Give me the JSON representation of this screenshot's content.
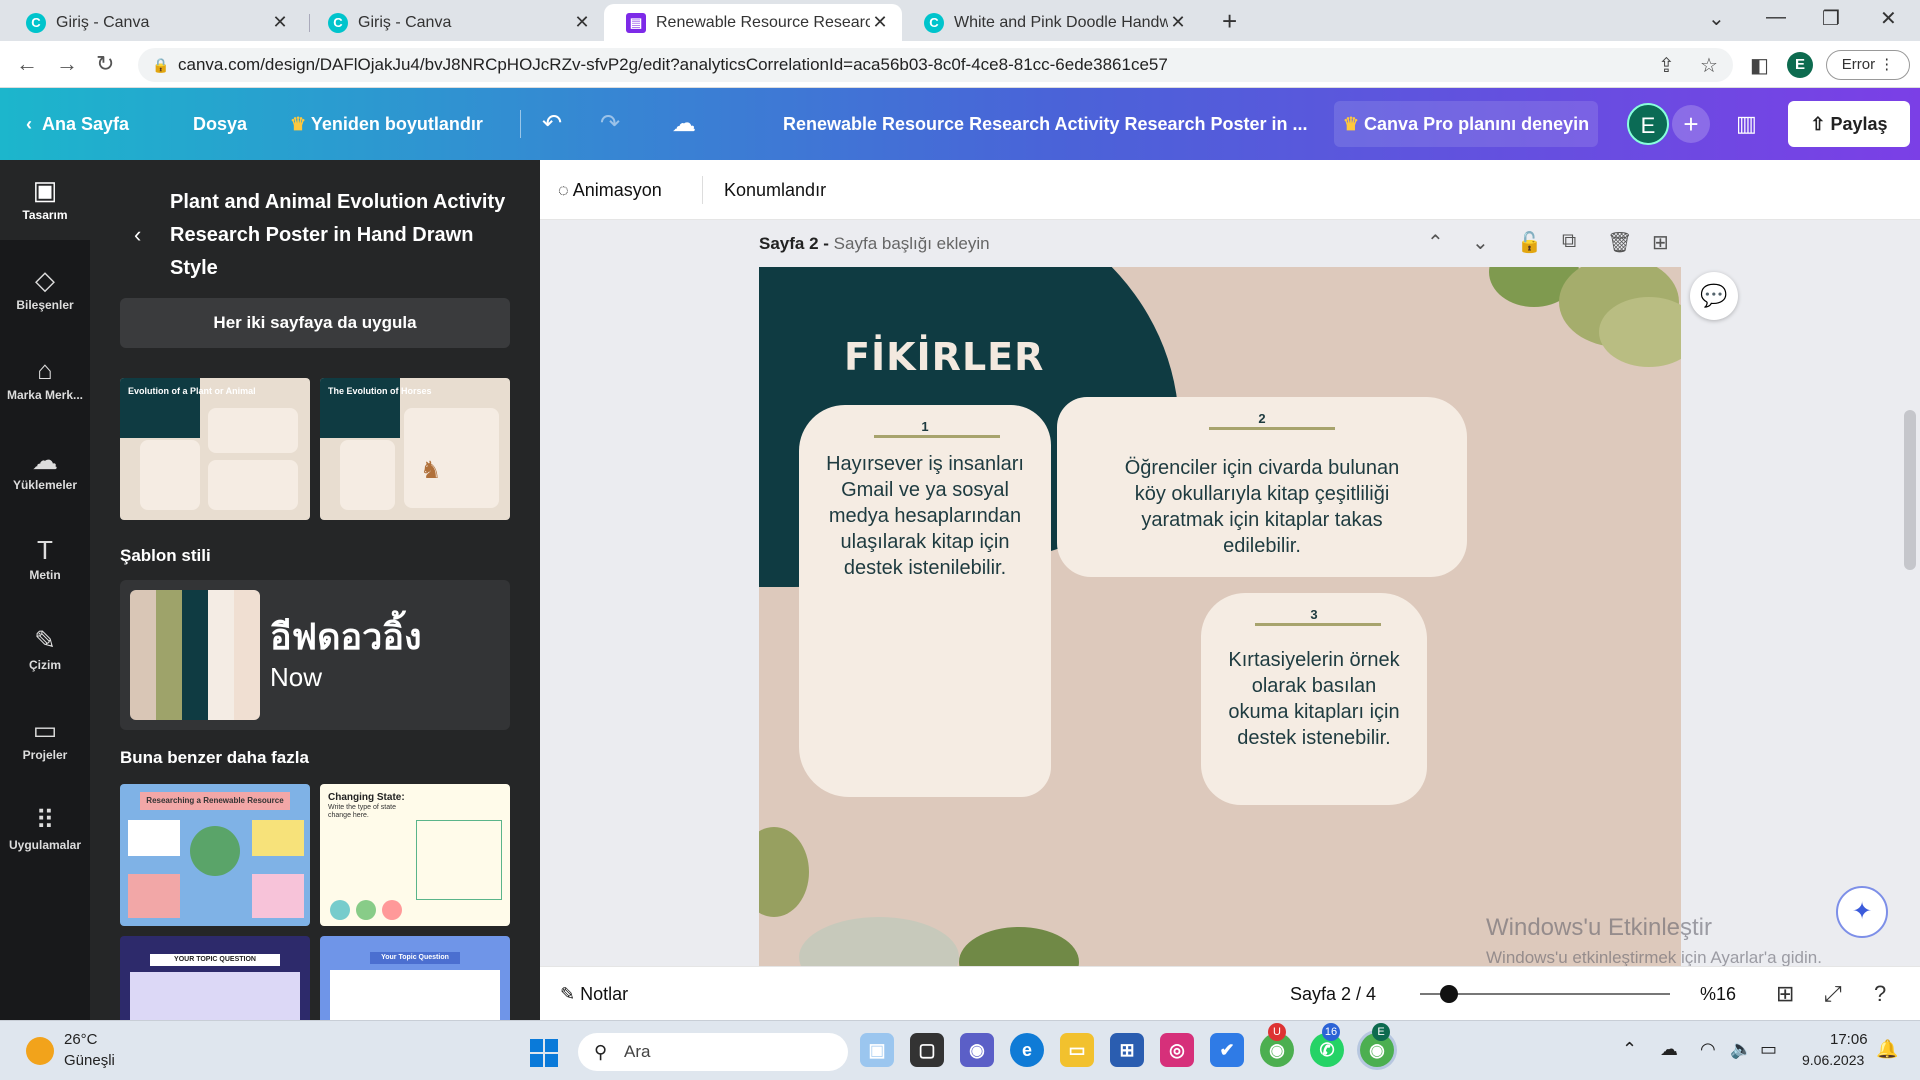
{
  "browser": {
    "tabs": [
      {
        "title": "Giriş - Canva",
        "active": false
      },
      {
        "title": "Giriş - Canva",
        "active": false
      },
      {
        "title": "Renewable Resource Research Ac",
        "active": true
      },
      {
        "title": "White and Pink Doodle Handwrit",
        "active": false
      }
    ],
    "url": "canva.com/design/DAFlOjakJu4/bvJ8NRCpHOJcRZv-sfvP2g/edit?analyticsCorrelationId=aca56b03-8c0f-4ce8-81cc-6ede3861ce57",
    "profile_initial": "E",
    "error_label": "Error"
  },
  "canva_header": {
    "home": "Ana Sayfa",
    "file": "Dosya",
    "resize": "Yeniden boyutlandır",
    "doc_title": "Renewable Resource Research Activity Research Poster in ...",
    "pro": "Canva Pro planını deneyin",
    "avatar": "E",
    "share": "Paylaş"
  },
  "rail": [
    {
      "label": "Tasarım",
      "icon": "layout-icon",
      "glyph": "▣",
      "active": true
    },
    {
      "label": "Bileşenler",
      "icon": "elements-icon",
      "glyph": "◇",
      "active": false
    },
    {
      "label": "Marka Merk...",
      "icon": "brand-icon",
      "glyph": "⌂",
      "active": false
    },
    {
      "label": "Yüklemeler",
      "icon": "upload-icon",
      "glyph": "☁",
      "active": false
    },
    {
      "label": "Metin",
      "icon": "text-icon",
      "glyph": "T",
      "active": false
    },
    {
      "label": "Çizim",
      "icon": "draw-icon",
      "glyph": "✎",
      "active": false
    },
    {
      "label": "Projeler",
      "icon": "folder-icon",
      "glyph": "▭",
      "active": false
    },
    {
      "label": "Uygulamalar",
      "icon": "apps-icon",
      "glyph": "⠿",
      "active": false
    }
  ],
  "panel": {
    "title": "Plant and Animal Evolution Activity Research Poster in Hand Drawn Style",
    "apply": "Her iki sayfaya da uygula",
    "thumb1_title": "Evolution of a Plant or Animal",
    "thumb2_title": "The Evolution of Horses",
    "style_heading": "Şablon stili",
    "style_font_a": "อีฟดอวอิ้ง",
    "style_font_b": "Now",
    "swatches": [
      "#d9c6b6",
      "#9ea36a",
      "#0f3b42",
      "#f4ece4",
      "#f0dfd2"
    ],
    "more_heading": "Buna benzer daha fazla",
    "more_thumb1": "Researching a Renewable Resource",
    "more_thumb2": "Changing State:",
    "more_thumb2_sub": "Write the type of state change here.",
    "more_thumb3": "YOUR TOPIC QUESTION",
    "more_thumb4": "Your Topic Question"
  },
  "toolbar": {
    "animation": "Animasyon",
    "position": "Konumlandır"
  },
  "page": {
    "label_bold": "Sayfa 2 -",
    "label_sub": "Sayfa başlığı ekleyin",
    "heading": "FİKİRLER",
    "cards": [
      {
        "num": "1",
        "text": "Hayırsever iş insanları Gmail ve ya sosyal medya hesaplarından ulaşılarak kitap için destek istenilebilir."
      },
      {
        "num": "2",
        "text": "Öğrenciler için civarda bulunan köy okullarıyla kitap çeşitliliği yaratmak için kitaplar takas edilebilir."
      },
      {
        "num": "3",
        "text": "Kırtasiyelerin örnek olarak basılan okuma kitapları için destek istenebilir."
      }
    ]
  },
  "watermark": {
    "line1": "Windows'u Etkinleştir",
    "line2": "Windows'u etkinleştirmek için Ayarlar'a gidin."
  },
  "bottombar": {
    "notes": "Notlar",
    "page_count": "Sayfa 2 / 4",
    "zoom": "%16",
    "zoom_level": 0.16
  },
  "taskbar": {
    "temp": "26°C",
    "weather": "Güneşli",
    "search": "Ara",
    "chrome_badge": "U",
    "whatsapp_badge": "16",
    "chrome2_badge": "E",
    "time": "17:06",
    "date": "9.06.2023"
  }
}
